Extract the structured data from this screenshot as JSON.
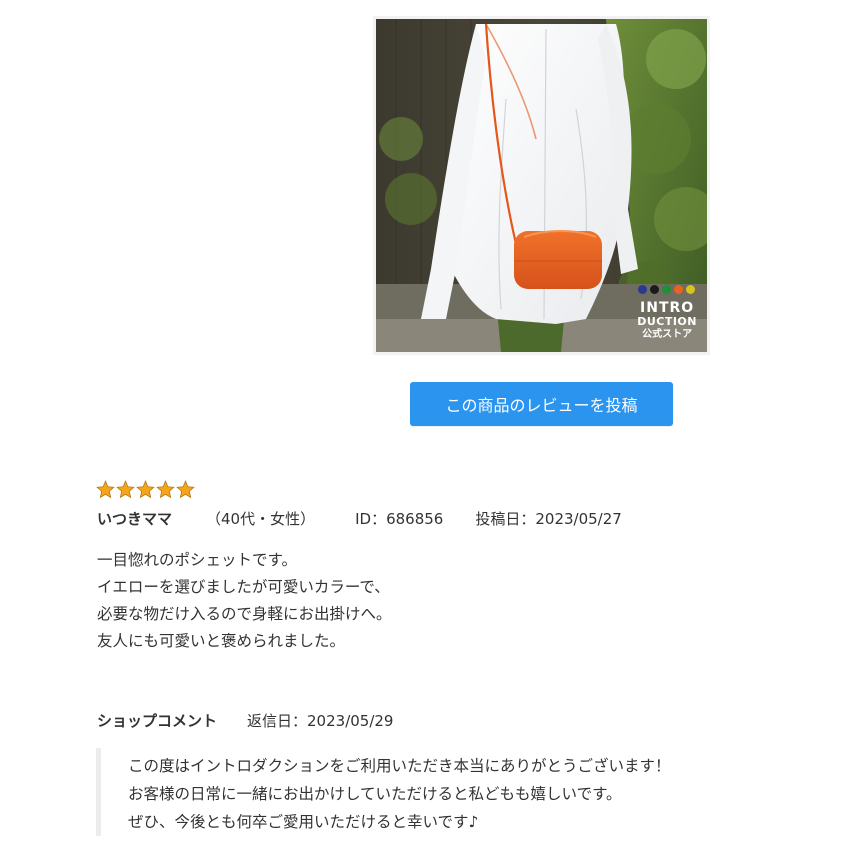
{
  "product_image": {
    "alt": "",
    "brand_colors": [
      "#2b3a8c",
      "#1a1a1a",
      "#1f8f3a",
      "#e8631c",
      "#d8c21e"
    ],
    "logo_line1": "INTRO",
    "logo_line2": "DUCTION",
    "logo_line3": "公式ストア"
  },
  "post_button": {
    "label": "この商品のレビューを投稿"
  },
  "review": {
    "rating": 5,
    "max_rating": 5,
    "star_color": "#f5a51c",
    "reviewer_name": "いつきママ",
    "reviewer_attrs": "（40代・女性）",
    "reviewer_id": "ID：686856",
    "posted_date": "投稿日：2023/05/27",
    "body_lines": [
      "一目惚れのポシェットです。",
      "イエローを選びましたが可愛いカラーで、",
      "必要な物だけ入るので身軽にお出掛けへ。",
      "友人にも可愛いと褒められました。"
    ]
  },
  "shop_comment": {
    "label": "ショップコメント",
    "reply_date": "返信日：2023/05/29",
    "body_lines": [
      "この度はイントロダクションをご利用いただき本当にありがとうございます！",
      "お客様の日常に一緒にお出かけしていただけると私どもも嬉しいです。",
      "ぜひ、今後とも何卒ご愛用いただけると幸いです♪"
    ]
  }
}
